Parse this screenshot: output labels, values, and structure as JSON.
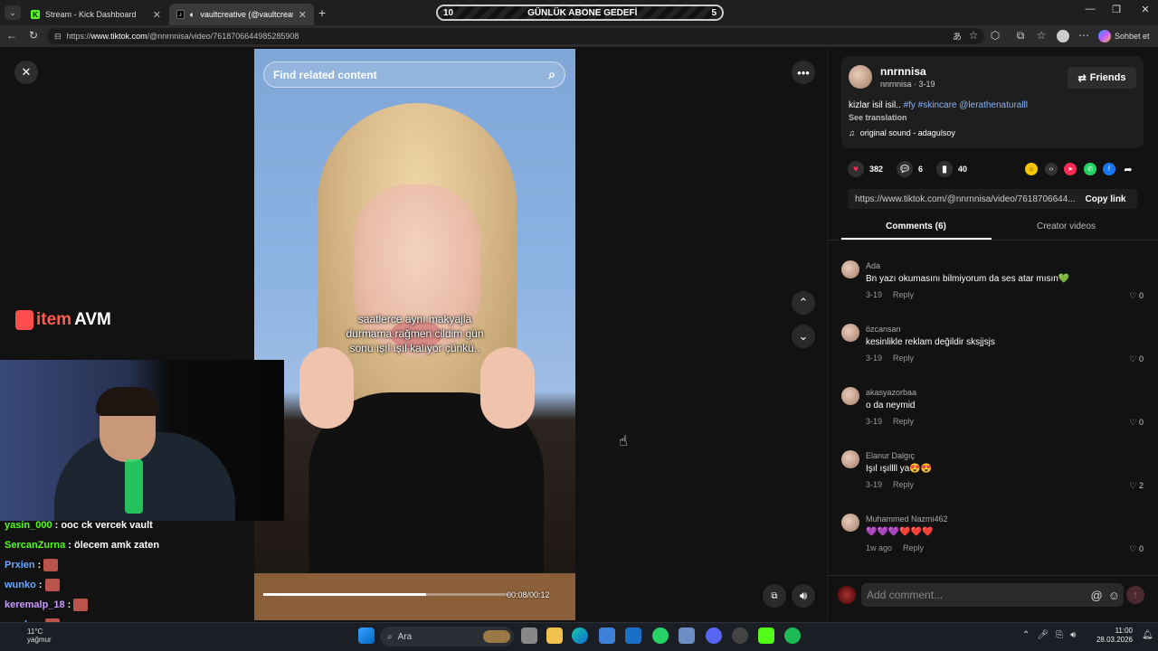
{
  "browser": {
    "tabs": [
      {
        "label": "Stream - Kick Dashboard",
        "active": false
      },
      {
        "label": "vaultcreative (@vaultcreative)",
        "active": true
      }
    ],
    "url_prefix": "https://",
    "url_domain": "www.tiktok.com",
    "url_path": "/@nnrnnisa/video/7618706644985285908",
    "chat_button": "Sohbet et"
  },
  "goal_bar": {
    "left": "10",
    "title": "GÜNLÜK ABONE GEDEFİ",
    "right": "5"
  },
  "video": {
    "search_placeholder": "Find related content",
    "caption_lines": [
      "saatlerce aynı makyajla",
      "durmama rağmen cildim gün",
      "sonu ışıl ışıl kalıyor çünkü.."
    ],
    "timecode": "00:08/00:12",
    "progress": 0.66
  },
  "overlay": {
    "logo_part1": "item",
    "logo_part2": "AVM",
    "chat": [
      {
        "user": "yasin_000",
        "text": ": ooc ck vercek vault",
        "color": "#53fc18"
      },
      {
        "user": "SercanZurna",
        "text": ": ölecem amk zaten",
        "color": "#53fc18"
      },
      {
        "user": "Prxien",
        "text": ":",
        "color": "#6aa8ff"
      },
      {
        "user": "wunko",
        "text": ":",
        "color": "#6aa8ff"
      },
      {
        "user": "keremalp_18",
        "text": ":",
        "color": "#c89bff"
      },
      {
        "user": "wunko",
        "text": ":",
        "color": "#6aa8ff"
      }
    ]
  },
  "post": {
    "display_name": "nnrnnisa",
    "handle_date": "nnrnnisa · 3-19",
    "friends_label": "Friends",
    "desc_text": "kizlar isil isil.. ",
    "desc_tags": "#fy #skincare @lerathenaturalll",
    "see_translation": "See translation",
    "sound": "original sound - adagulsoy",
    "likes": "382",
    "comments": "6",
    "saves": "40",
    "link": "https://www.tiktok.com/@nnrnnisa/video/7618706644...",
    "copy_label": "Copy link",
    "tab_comments": "Comments (6)",
    "tab_creator": "Creator videos"
  },
  "comments": [
    {
      "name": "Ada",
      "text": "Bn yazı okumasını bilmiyorum da ses atar mısın💚",
      "date": "3-19",
      "reply": "Reply",
      "likes": "0"
    },
    {
      "name": "özcansan",
      "text": "kesinlikle reklam değildir sksjjsjs",
      "date": "3-19",
      "reply": "Reply",
      "likes": "0"
    },
    {
      "name": "akasyazorbaa",
      "text": "o da neymid",
      "date": "3-19",
      "reply": "Reply",
      "likes": "0"
    },
    {
      "name": "Elanur Dalgıç",
      "text": "Işıl ışıllll ya😍😍",
      "date": "3-19",
      "reply": "Reply",
      "likes": "2"
    },
    {
      "name": "Muhammed Nazmi462",
      "text": "💜💜💜❤️❤️❤️",
      "date": "1w ago",
      "reply": "Reply",
      "likes": "0"
    }
  ],
  "comment_input": {
    "placeholder": "Add comment..."
  },
  "taskbar": {
    "search": "Ara",
    "weather_temp": "11°C",
    "weather_text": "yağmur",
    "time": "11:00",
    "date": "28.03.2026"
  }
}
